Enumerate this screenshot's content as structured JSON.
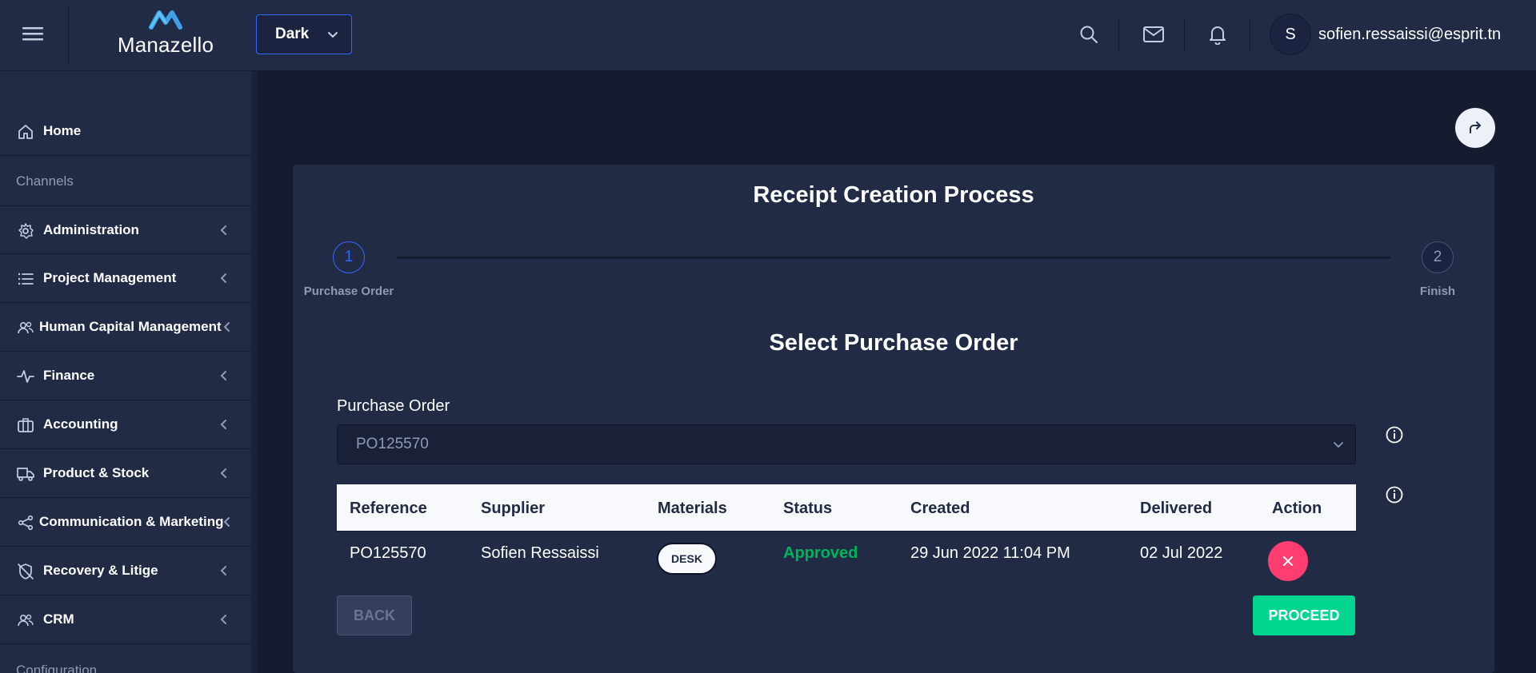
{
  "header": {
    "logo_text": "Manazello",
    "theme": {
      "selected": "Dark"
    },
    "user": {
      "avatar_initial": "S",
      "email": "sofien.ressaissi@esprit.tn"
    }
  },
  "sidebar": {
    "items": [
      {
        "label": "Home",
        "icon": "home-icon"
      },
      {
        "label": "Administration",
        "icon": "settings-icon"
      },
      {
        "label": "Project Management",
        "icon": "list-icon"
      },
      {
        "label": "Human Capital Management",
        "icon": "people-icon"
      },
      {
        "label": "Finance",
        "icon": "activity-icon"
      },
      {
        "label": "Accounting",
        "icon": "briefcase-icon"
      },
      {
        "label": "Product & Stock",
        "icon": "truck-icon"
      },
      {
        "label": "Communication & Marketing",
        "icon": "share-icon"
      },
      {
        "label": "Recovery & Litige",
        "icon": "shield-off-icon"
      },
      {
        "label": "CRM",
        "icon": "people-icon"
      }
    ],
    "groups": {
      "channels": "Channels",
      "configuration": "Configuration"
    }
  },
  "main": {
    "title": "Receipt Creation Process",
    "steps": [
      {
        "number": "1",
        "label": "Purchase Order",
        "active": true
      },
      {
        "number": "2",
        "label": "Finish",
        "active": false
      }
    ],
    "section_title": "Select Purchase Order",
    "purchase_order_label": "Purchase Order",
    "purchase_order_value": "PO125570",
    "table": {
      "columns": [
        "Reference",
        "Supplier",
        "Materials",
        "Status",
        "Created",
        "Delivered",
        "Action"
      ],
      "rows": [
        {
          "reference": "PO125570",
          "supplier": "Sofien Ressaissi",
          "material": "DESK",
          "status": "Approved",
          "created": "29 Jun 2022 11:04 PM",
          "delivered": "02 Jul 2022"
        }
      ]
    },
    "back_label": "BACK",
    "proceed_label": "PROCEED"
  },
  "colors": {
    "background": "#151c30",
    "panel": "#222b45",
    "primary": "#3366ff",
    "success": "#00d68f",
    "danger": "#ff3d71",
    "approved": "#00b35a"
  }
}
